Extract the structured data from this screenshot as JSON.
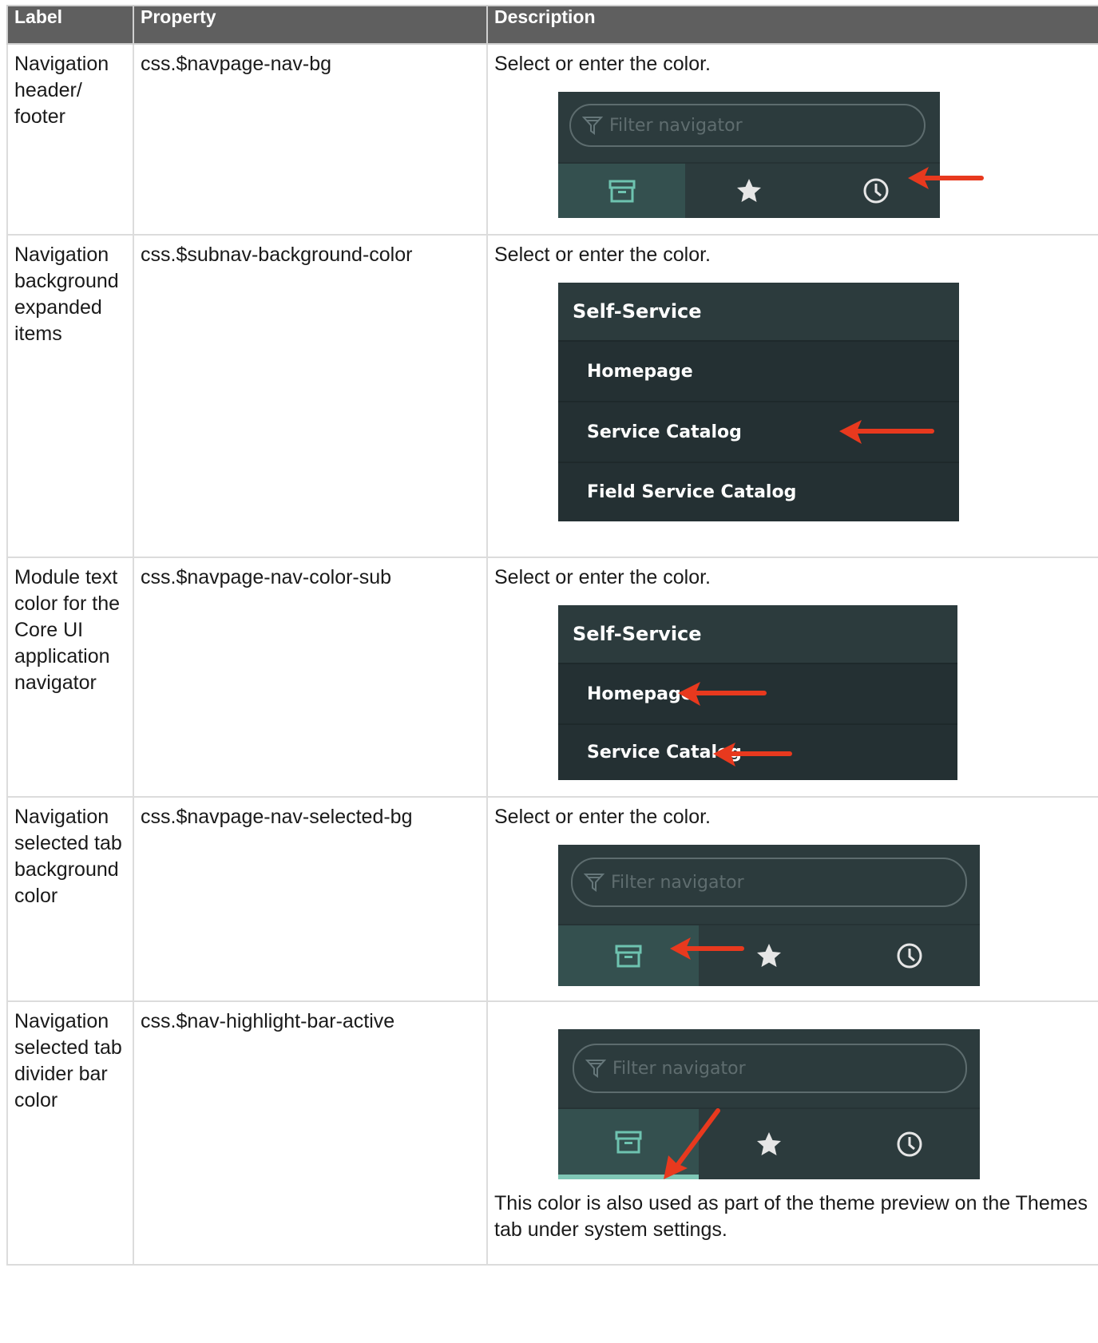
{
  "table": {
    "headers": [
      "Label",
      "Property",
      "Description"
    ],
    "rows": [
      {
        "label": "Navigation header/ footer",
        "property": "css.$navpage-nav-bg",
        "description": "Select or enter the color."
      },
      {
        "label": "Navigation background expanded items",
        "property": "css.$subnav-background-color",
        "description": "Select or enter the color."
      },
      {
        "label": "Module text color for the Core UI application navigator",
        "property": "css.$navpage-nav-color-sub",
        "description": "Select or enter the color."
      },
      {
        "label": "Navigation selected tab background color",
        "property": "css.$navpage-nav-selected-bg",
        "description": "Select or enter the color."
      },
      {
        "label": "Navigation selected tab divider bar color",
        "property": "css.$nav-highlight-bar-active",
        "description": "",
        "note": "This color is also used as part of the theme preview on the Themes tab under system settings."
      }
    ]
  },
  "screenshots": {
    "filter_placeholder": "Filter navigator",
    "menu_header": "Self-Service",
    "menu_items_expanded": [
      "Homepage",
      "Service Catalog",
      "Field Service Catalog"
    ],
    "menu_items_module": [
      "Homepage",
      "Service Catalog"
    ],
    "tab_icons": [
      "archive-box-icon",
      "star-icon",
      "clock-icon"
    ]
  },
  "colors": {
    "header_bg": "#5f5f5f",
    "nav_bg": "#2c3b3d",
    "nav_selected_tab": "#34504f",
    "subnav_bg": "#243033",
    "highlight_bar": "#7fc7b6",
    "arrow": "#e8391e"
  }
}
